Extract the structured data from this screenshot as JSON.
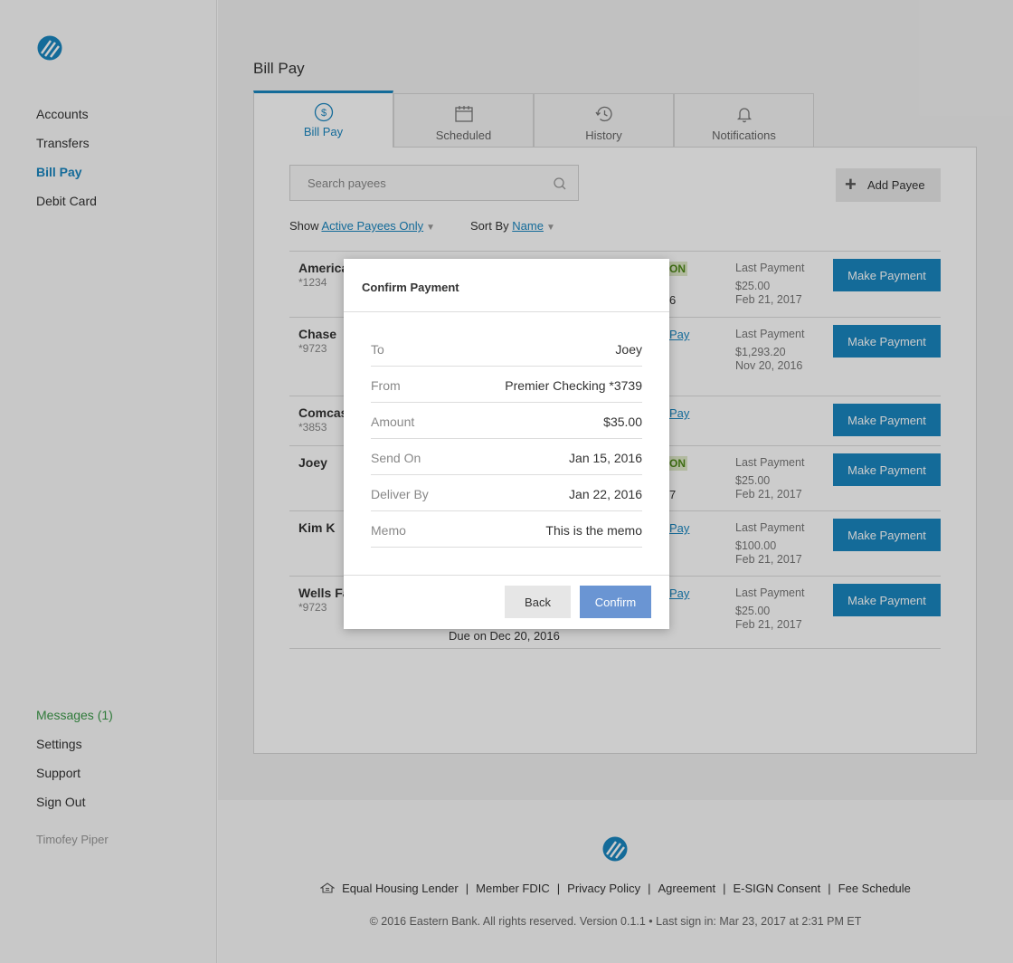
{
  "sidebar": {
    "logo_icon": "bank-logo-icon",
    "nav": [
      "Accounts",
      "Transfers",
      "Bill Pay",
      "Debit Card"
    ],
    "active_nav": "Bill Pay",
    "bottom": [
      "Messages (1)",
      "Settings",
      "Support",
      "Sign Out"
    ],
    "user": "Timofey Piper"
  },
  "page": {
    "title": "Bill Pay",
    "tabs": [
      {
        "label": "Bill Pay",
        "icon": "dollar-circle-icon",
        "active": true
      },
      {
        "label": "Scheduled",
        "icon": "calendar-icon",
        "active": false
      },
      {
        "label": "History",
        "icon": "history-clock-icon",
        "active": false
      },
      {
        "label": "Notifications",
        "icon": "bell-icon",
        "active": false
      }
    ]
  },
  "toolbar": {
    "search_placeholder": "Search payees",
    "add_payee": "Add Payee",
    "show_label": "Show",
    "show_value": "Active Payees Only",
    "sort_label": "Sort By",
    "sort_value": "Name"
  },
  "payees": [
    {
      "name": "America",
      "account": "*1234",
      "frag1": "ON",
      "frag2": "6",
      "last_payment_label": "Last Payment",
      "last_amount": "$25.00",
      "last_date": "Feb 21, 2017",
      "button": "Make Payment"
    },
    {
      "name": "Chase",
      "account": "*9723",
      "frag1": "Pay",
      "last_payment_label": "Last Payment",
      "last_amount": "$1,293.20",
      "last_date": "Nov 20, 2016",
      "button": "Make Payment"
    },
    {
      "name": "Comcas",
      "account": "*3853",
      "frag1": "Pay",
      "button": "Make Payment"
    },
    {
      "name": "Joey",
      "account": "",
      "frag1": "ON",
      "frag2": "7",
      "last_payment_label": "Last Payment",
      "last_amount": "$25.00",
      "last_date": "Feb 21, 2017",
      "button": "Make Payment"
    },
    {
      "name": "Kim K",
      "account": "",
      "frag1": "Pay",
      "last_payment_label": "Last Payment",
      "last_amount": "$100.00",
      "last_date": "Feb 21, 2017",
      "button": "Make Payment"
    },
    {
      "name": "Wells Fa",
      "account": "*9723",
      "frag1": "Pay",
      "due": "Due on Dec 20, 2016",
      "last_payment_label": "Last Payment",
      "last_amount": "$25.00",
      "last_date": "Feb 21, 2017",
      "button": "Make Payment"
    }
  ],
  "modal": {
    "title": "Confirm Payment",
    "rows": [
      {
        "label": "To",
        "value": "Joey"
      },
      {
        "label": "From",
        "value": "Premier Checking *3739"
      },
      {
        "label": "Amount",
        "value": "$35.00"
      },
      {
        "label": "Send On",
        "value": "Jan 15, 2016"
      },
      {
        "label": "Deliver By",
        "value": "Jan 22, 2016"
      },
      {
        "label": "Memo",
        "value": "This is the memo"
      }
    ],
    "back": "Back",
    "confirm": "Confirm"
  },
  "footer": {
    "links": [
      "Equal Housing Lender",
      "Member FDIC",
      "Privacy Policy",
      "Agreement",
      "E-SIGN Consent",
      "Fee Schedule"
    ],
    "copyright": "© 2016 Eastern Bank. All rights reserved. Version 0.1.1 • Last sign in: Mar 23, 2017 at 2:31 PM ET"
  },
  "colors": {
    "accent": "#1a86c0",
    "confirm_button": "#6a95d3",
    "messages": "#3d9a4a"
  }
}
